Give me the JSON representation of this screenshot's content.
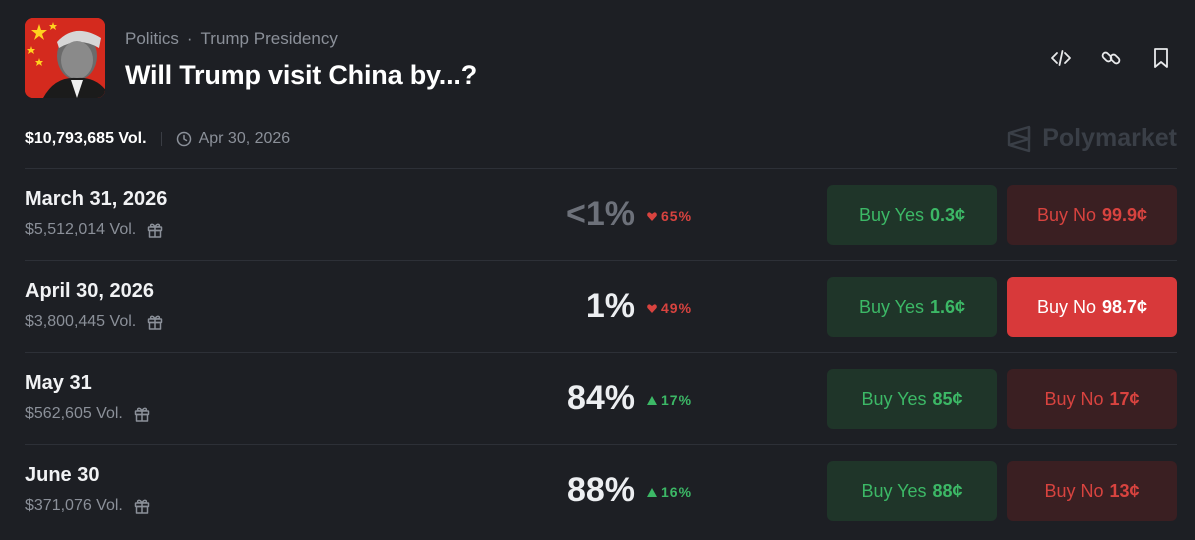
{
  "header": {
    "category": "Politics",
    "subcategory": "Trump Presidency",
    "separator": "·",
    "title": "Will Trump visit China by...?"
  },
  "meta": {
    "volume": "$10,793,685 Vol.",
    "end_date": "Apr 30, 2026"
  },
  "brand": {
    "name": "Polymarket"
  },
  "icons": [
    "embed-icon",
    "link-icon",
    "bookmark-icon",
    "clock-icon",
    "gift-icon",
    "polymarket-logo-icon"
  ],
  "colors": {
    "background": "#1d1f24",
    "yes_green": "#3cb866",
    "no_red": "#d8433f",
    "active_no": "#d8393a"
  },
  "markets": [
    {
      "name": "March 31, 2026",
      "volume": "$5,512,014 Vol.",
      "probability": "<1%",
      "change": "65%",
      "direction": "down",
      "yes_label": "Buy Yes",
      "yes_price": "0.3¢",
      "no_label": "Buy No",
      "no_price": "99.9¢",
      "no_active": false
    },
    {
      "name": "April 30, 2026",
      "volume": "$3,800,445 Vol.",
      "probability": "1%",
      "change": "49%",
      "direction": "down",
      "yes_label": "Buy Yes",
      "yes_price": "1.6¢",
      "no_label": "Buy No",
      "no_price": "98.7¢",
      "no_active": true
    },
    {
      "name": "May 31",
      "volume": "$562,605 Vol.",
      "probability": "84%",
      "change": "17%",
      "direction": "up",
      "yes_label": "Buy Yes",
      "yes_price": "85¢",
      "no_label": "Buy No",
      "no_price": "17¢",
      "no_active": false
    },
    {
      "name": "June 30",
      "volume": "$371,076 Vol.",
      "probability": "88%",
      "change": "16%",
      "direction": "up",
      "yes_label": "Buy Yes",
      "yes_price": "88¢",
      "no_label": "Buy No",
      "no_price": "13¢",
      "no_active": false
    }
  ]
}
